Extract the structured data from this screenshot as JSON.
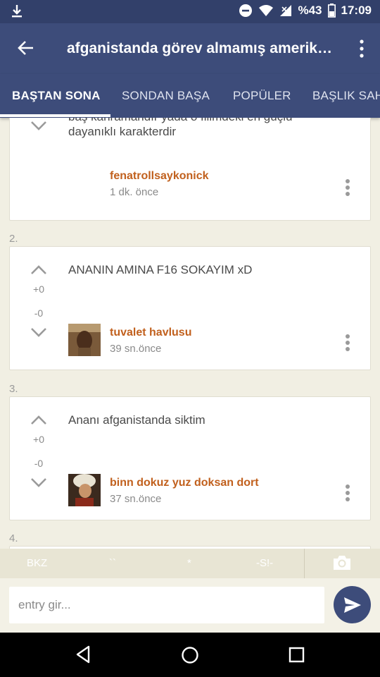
{
  "status_bar": {
    "battery": "%43",
    "time": "17:09",
    "icons": [
      "download-icon",
      "dnd-icon",
      "wifi-icon",
      "signal-icon",
      "battery-icon"
    ]
  },
  "app_bar": {
    "title": "afganistanda görev almamış amerikan askeri",
    "back_icon": "arrow-left-icon",
    "menu_icon": "more-vert-icon"
  },
  "tabs": [
    {
      "label": "BAŞTAN SONA"
    },
    {
      "label": "SONDAN BAŞA"
    },
    {
      "label": "POPÜLER"
    },
    {
      "label": "BAŞLIK SAHİBİ"
    }
  ],
  "entries": [
    {
      "text_line1": "baş kahramandır yada o filimdeki en güçlü",
      "text_line2": "dayanıklı karakterdir",
      "author": "fenatrollsaykonick",
      "time": "1 dk. önce"
    },
    {
      "number": "2.",
      "text": "ANANIN AMINA F16 SOKAYIM xD",
      "up": "+0",
      "down": "-0",
      "author": "tuvalet havlusu",
      "time": "39 sn.önce"
    },
    {
      "number": "3.",
      "text": "Ananı afganistanda siktim",
      "up": "+0",
      "down": "-0",
      "author": "binn dokuz yuz doksan dort",
      "time": "37 sn.önce"
    },
    {
      "number": "4."
    }
  ],
  "toolbar": {
    "bkz": "BKZ",
    "backtick": "``",
    "star": "*",
    "spoiler": "-S!-",
    "camera_icon": "camera-icon"
  },
  "composer": {
    "placeholder": "entry gir...",
    "send_icon": "send-icon"
  },
  "nav": {
    "back": "nav-back-icon",
    "home": "nav-home-icon",
    "recent": "nav-recent-icon"
  },
  "colors": {
    "primary": "#3d4c7a",
    "accent_author": "#c1601d",
    "background": "#f1efe3"
  }
}
